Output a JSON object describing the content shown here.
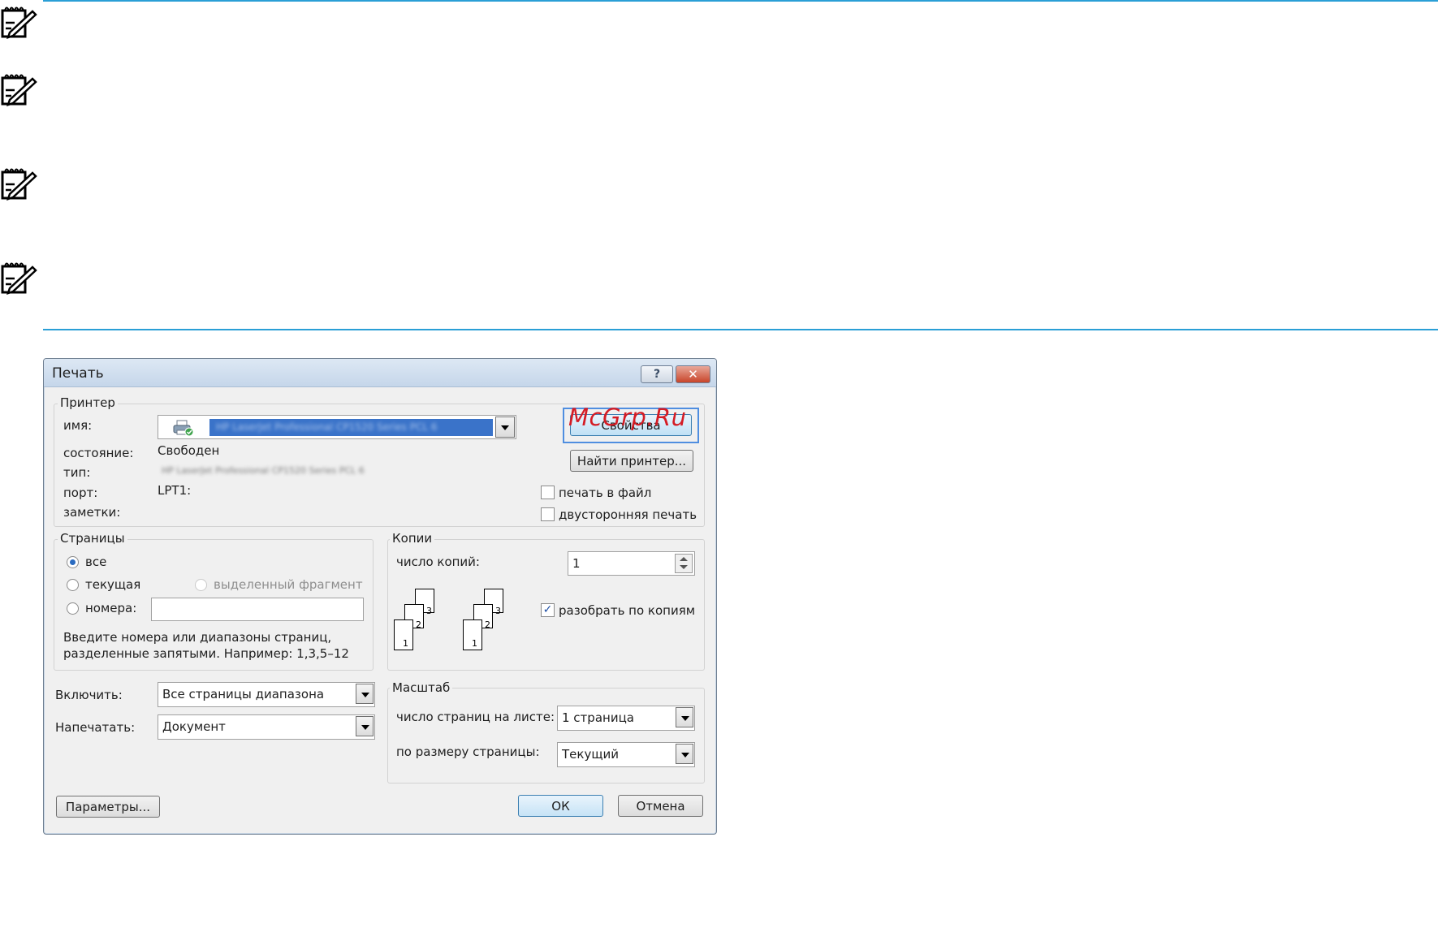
{
  "dialog": {
    "title": "Печать",
    "help_glyph": "?",
    "close_glyph": "✕"
  },
  "printer": {
    "group_label": "Принтер",
    "name_label": "имя:",
    "name_value": "HP LaserJet Professional CP1520 Series PCL 6",
    "status_label": "состояние:",
    "status_value": "Свободен",
    "type_label": "тип:",
    "type_value": "HP LaserJet Professional CP1520 Series PCL 6",
    "port_label": "порт:",
    "port_value": "LPT1:",
    "notes_label": "заметки:",
    "properties_button": "Свойства",
    "find_printer_button": "Найти принтер...",
    "print_to_file_label": "печать в файл",
    "duplex_label": "двусторонняя печать"
  },
  "pages": {
    "group_label": "Страницы",
    "all_label": "все",
    "current_label": "текущая",
    "selection_label": "выделенный фрагмент",
    "numbers_label": "номера:",
    "hint": "Введите номера или диапазоны страниц, разделенные запятыми. Например: 1,3,5–12"
  },
  "copies": {
    "group_label": "Копии",
    "count_label": "число копий:",
    "count_value": "1",
    "collate_label": "разобрать по копиям",
    "page_numbers": [
      "1",
      "2",
      "3"
    ]
  },
  "include": {
    "label": "Включить:",
    "value": "Все страницы диапазона"
  },
  "print_what": {
    "label": "Напечатать:",
    "value": "Документ"
  },
  "scale": {
    "group_label": "Масштаб",
    "pages_per_sheet_label": "число страниц на листе:",
    "pages_per_sheet_value": "1 страница",
    "fit_to_label": "по размеру страницы:",
    "fit_to_value": "Текущий"
  },
  "footer": {
    "options_button": "Параметры...",
    "ok_button": "ОК",
    "cancel_button": "Отмена"
  },
  "watermark": "McGrp.Ru",
  "colors": {
    "rule": "#2a9fd6",
    "title_bar": "#c5d6ea",
    "watermark": "#d41c25",
    "selection": "#3a73c9"
  }
}
